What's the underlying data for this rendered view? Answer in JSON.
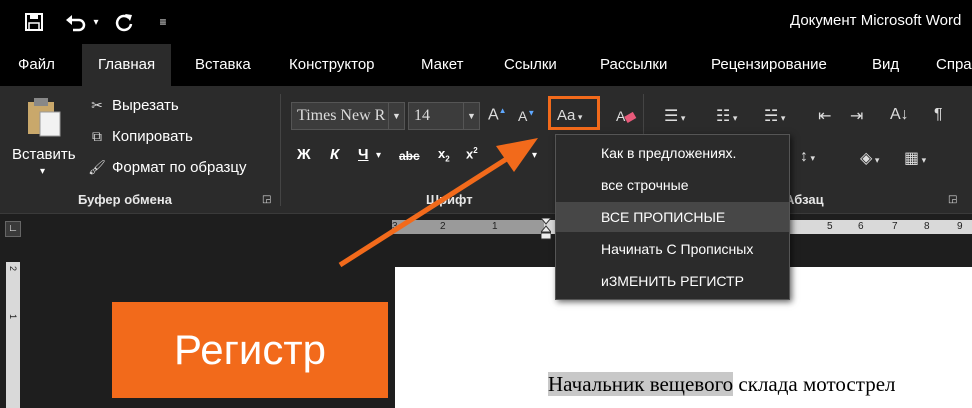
{
  "window": {
    "title": "Документ Microsoft Word",
    "qat_icons": [
      "save-icon",
      "undo-icon",
      "redo-icon",
      "customize-icon"
    ]
  },
  "tabs": [
    "Файл",
    "Главная",
    "Вставка",
    "Конструктор",
    "Макет",
    "Ссылки",
    "Рассылки",
    "Рецензирование",
    "Вид",
    "Спра"
  ],
  "active_tab": "Главная",
  "clipboard": {
    "paste_label": "Вставить",
    "cut_label": "Вырезать",
    "copy_label": "Копировать",
    "format_painter_label": "Формат по образцу",
    "group_label": "Буфер обмена"
  },
  "font": {
    "font_name": "Times New R",
    "font_size": "14",
    "group_label": "Шрифт",
    "change_case_label": "Aa",
    "bold": "Ж",
    "italic": "К",
    "underline": "Ч",
    "strike": "abc"
  },
  "paragraph": {
    "group_label": "Абзац"
  },
  "change_case_menu": [
    "Как в предложениях.",
    "все строчные",
    "ВСЕ ПРОПИСНЫЕ",
    "Начинать С Прописных",
    "иЗМЕНИТЬ РЕГИСТР"
  ],
  "hovered_menu_index": 2,
  "ruler": {
    "left_marks": [
      "3",
      "2",
      "1"
    ],
    "right_marks": [
      "5",
      "6",
      "7",
      "8",
      "9"
    ],
    "vertical_marks": [
      "2",
      "1"
    ]
  },
  "document": {
    "text_highlighted": "Начальник вещевого",
    "text_rest": " склада мотострел"
  },
  "callout": {
    "label": "Регистр"
  },
  "colors": {
    "accent": "#f26a1b",
    "ribbon": "#2b2b2b",
    "titlebar": "#000000"
  }
}
